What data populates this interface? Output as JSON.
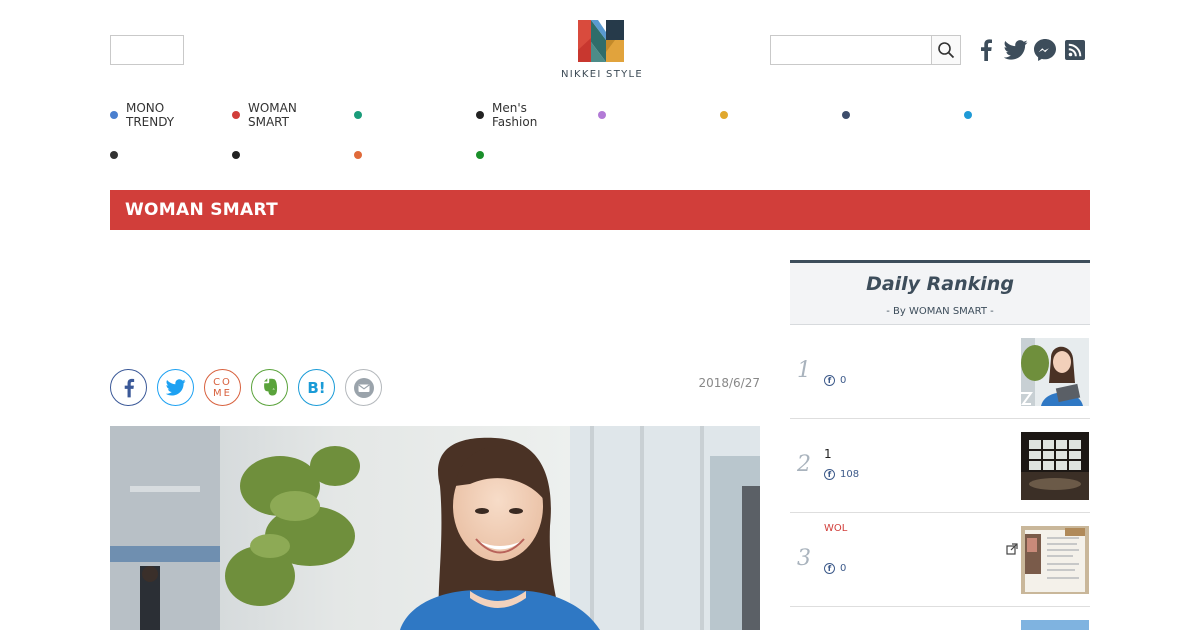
{
  "brand": {
    "logo_text": "NIKKEI STYLE"
  },
  "search": {
    "value": "",
    "placeholder": ""
  },
  "social_icons": [
    "facebook-icon",
    "twitter-icon",
    "messenger-icon",
    "rss-icon"
  ],
  "categories": [
    {
      "label": "MONO\nTRENDY",
      "color": "#4a7fcf"
    },
    {
      "label": "WOMAN\nSMART",
      "color": "#d13e3a"
    },
    {
      "label": "",
      "color": "#1a9c7a"
    },
    {
      "label": "Men's\nFashion",
      "color": "#222222"
    },
    {
      "label": "",
      "color": "#b27ad6"
    },
    {
      "label": "",
      "color": "#e0a82e"
    },
    {
      "label": "",
      "color": "#3d4d6b"
    },
    {
      "label": "",
      "color": "#1f9ad6"
    },
    {
      "label": "",
      "color": "#333333"
    },
    {
      "label": "",
      "color": "#222222"
    },
    {
      "label": "",
      "color": "#e06a3a"
    },
    {
      "label": "",
      "color": "#1a8f2a"
    }
  ],
  "section": {
    "title": "WOMAN SMART",
    "color": "#d13e3a"
  },
  "share": {
    "buttons": [
      "facebook-share",
      "twitter-share",
      "come-share",
      "evernote-share",
      "hatena-bookmark-share",
      "mail-share"
    ],
    "come_label": "CO\nME",
    "hatena_label": "B!"
  },
  "article": {
    "date": "2018/6/27"
  },
  "ranking": {
    "title": "Daily Ranking",
    "subtitle": "- By WOMAN SMART -",
    "items": [
      {
        "rank": "1",
        "tag": "",
        "text": "",
        "fb_count": "0"
      },
      {
        "rank": "2",
        "tag": "",
        "text": "1",
        "fb_count": "108"
      },
      {
        "rank": "3",
        "tag": "WOL",
        "text": "",
        "fb_count": "0"
      }
    ]
  },
  "colors": {
    "accent_red": "#d13e3a",
    "navy": "#3d4d5b"
  }
}
